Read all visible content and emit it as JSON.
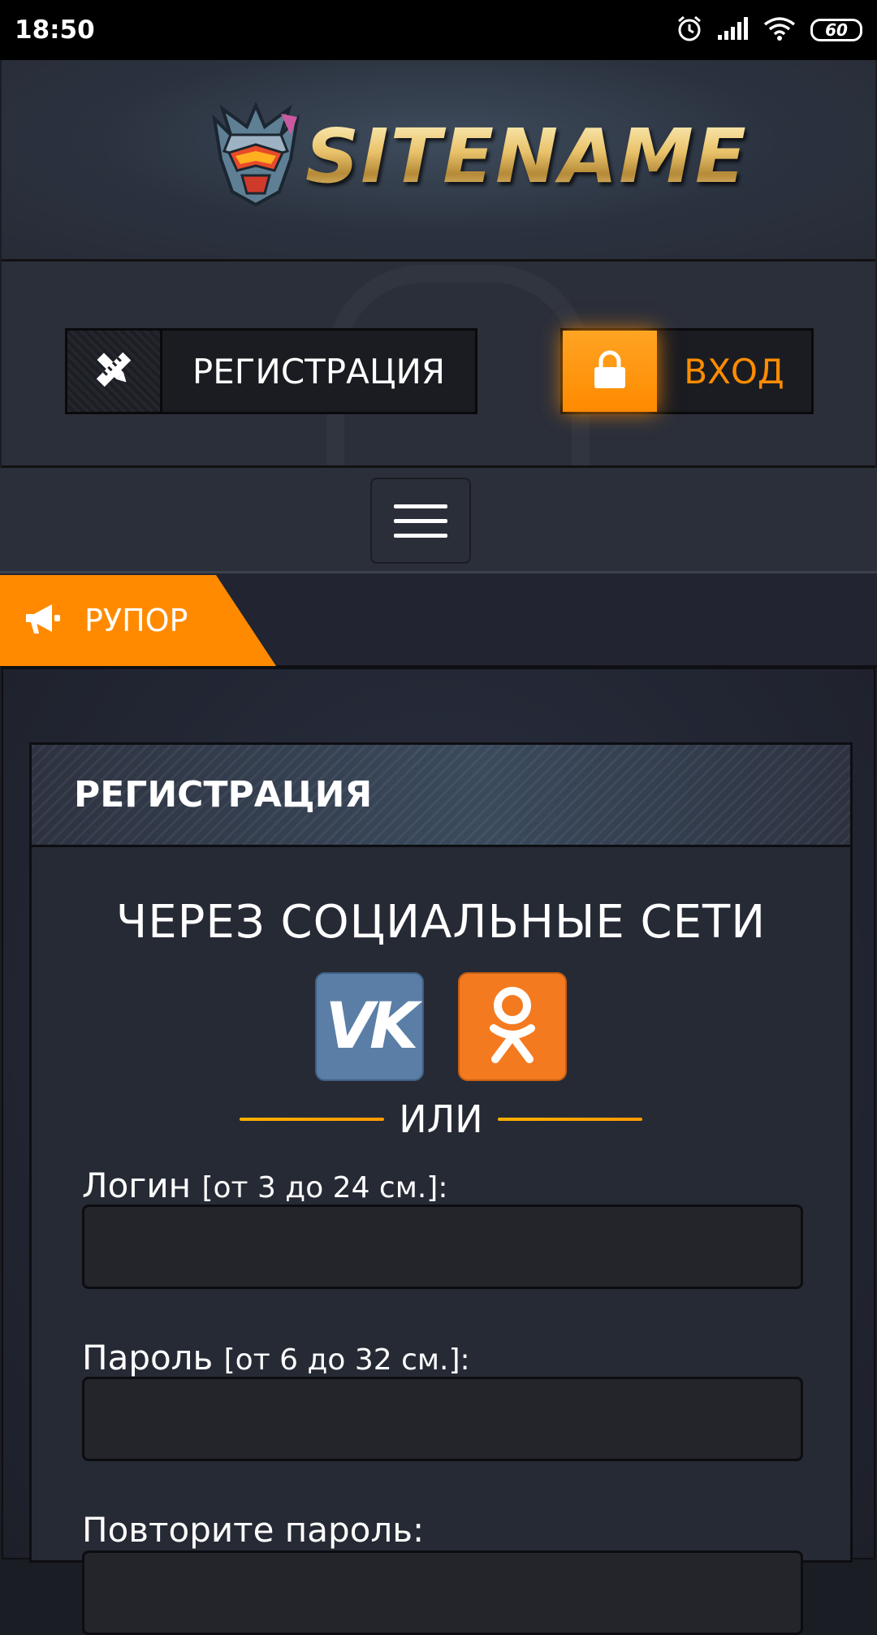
{
  "status_bar": {
    "time": "18:50",
    "battery": "60",
    "icons": [
      "alarm-icon",
      "signal-icon",
      "wifi-icon",
      "battery-icon"
    ]
  },
  "header": {
    "logo_text": "SITENAME"
  },
  "auth": {
    "register_label": "РЕГИСТРАЦИЯ",
    "login_label": "ВХОД"
  },
  "ticker": {
    "label": "РУПОР"
  },
  "panel": {
    "title": "РЕГИСТРАЦИЯ",
    "social_title": "ЧЕРЕЗ СОЦИАЛЬНЫЕ СЕТИ",
    "social": [
      {
        "name": "vk",
        "glyph": "VK",
        "color": "#5a7ea6"
      },
      {
        "name": "ok",
        "color": "#f47a20"
      }
    ],
    "or_label": "ИЛИ",
    "fields": [
      {
        "label": "Логин",
        "hint": "[от 3 до 24 см.]:",
        "value": ""
      },
      {
        "label": "Пароль",
        "hint": "[от 6 до 32 см.]:",
        "value": ""
      },
      {
        "label": "Повторите пароль:",
        "hint": "",
        "value": ""
      }
    ]
  },
  "colors": {
    "accent": "#ff8a00",
    "background": "#1b1d24"
  }
}
